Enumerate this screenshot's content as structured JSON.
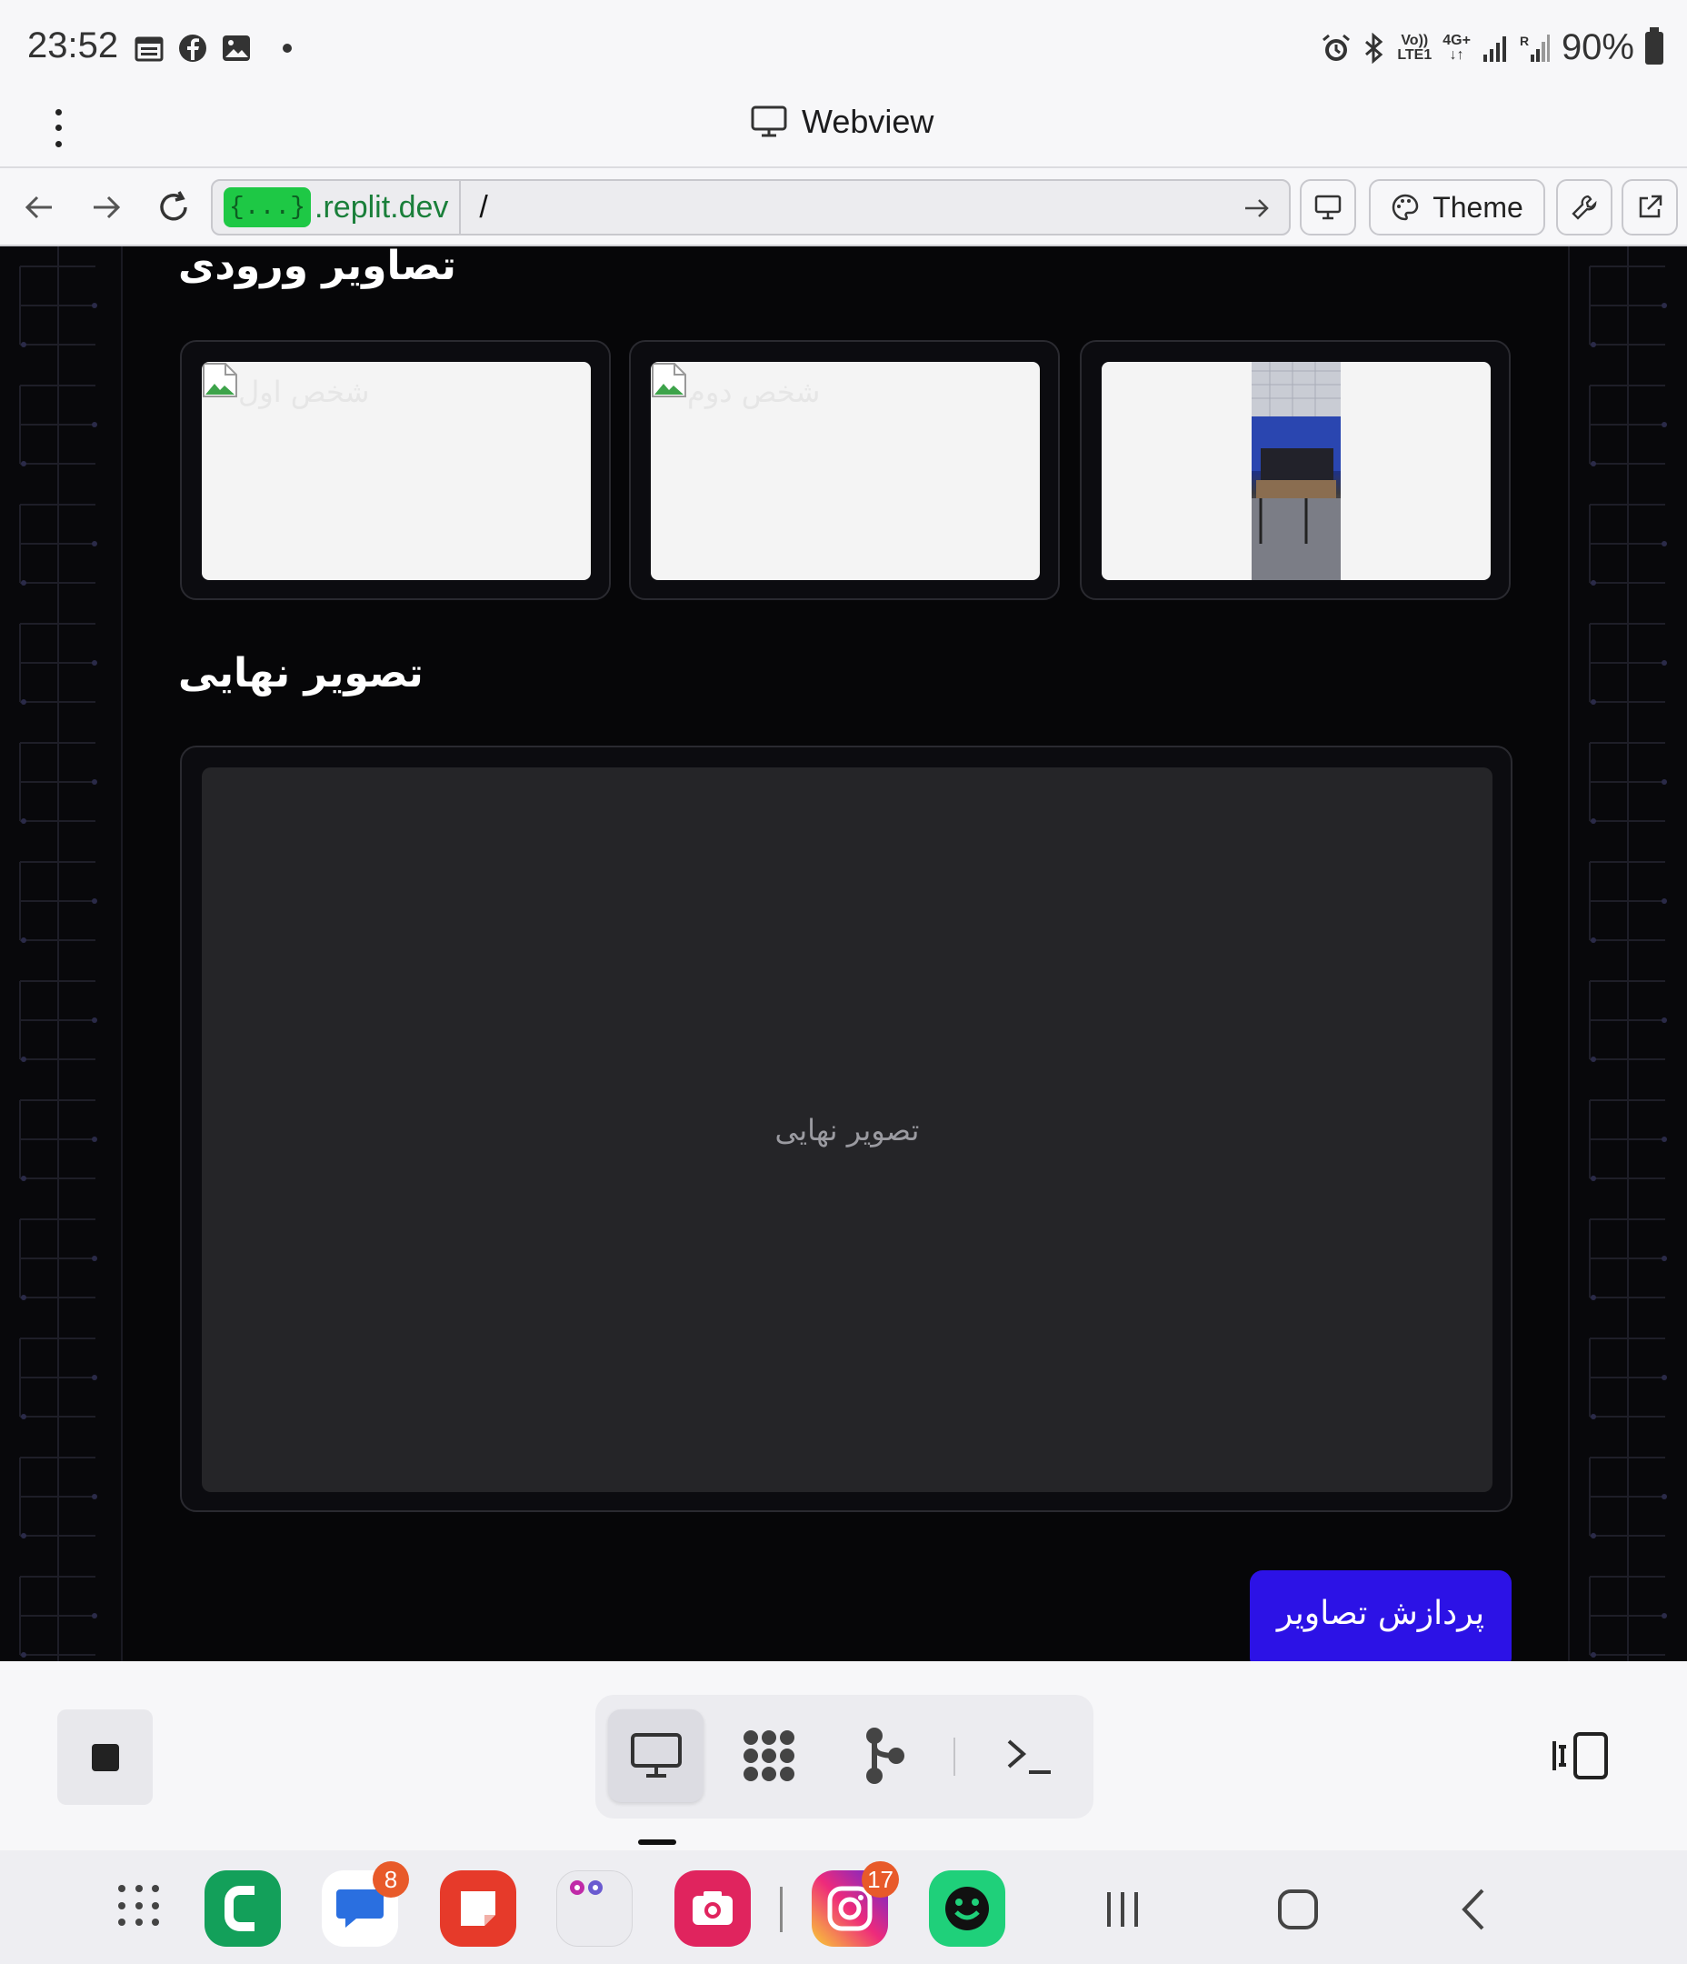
{
  "status_bar": {
    "time": "23:52",
    "left_icons": [
      "calendar-icon",
      "facebook-icon",
      "gallery-icon"
    ],
    "network_top": "Vo))",
    "network_bottom": "LTE1",
    "network2_top": "4G+",
    "network2_bottom": "↓↑",
    "battery": "90%"
  },
  "title_bar": {
    "title": "Webview"
  },
  "url_bar": {
    "chip": "{...}",
    "host": ".replit.dev",
    "path": "/",
    "theme_label": "Theme"
  },
  "page": {
    "inputs_title": "تصاویر ورودی",
    "input_cards": [
      {
        "alt": "شخص اول",
        "state": "broken"
      },
      {
        "alt": "شخص دوم",
        "state": "broken"
      },
      {
        "alt": "",
        "state": "photo"
      }
    ],
    "result_title": "تصویر نهایی",
    "result_placeholder": "تصویر نهایی",
    "process_button": "پردازش تصاویر"
  },
  "dock": {
    "messages_badge": "8",
    "instagram_badge": "17"
  },
  "colors": {
    "accent": "#2c12e6",
    "page_bg": "#08080b",
    "repl_green": "#1ec845"
  }
}
